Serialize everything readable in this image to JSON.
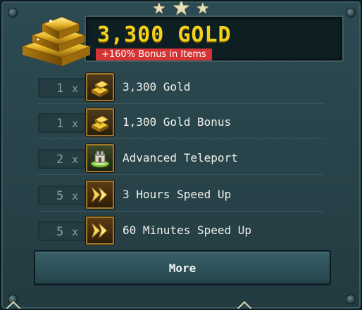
{
  "offer": {
    "title": "3,300 GOLD",
    "bonus_badge": "+160% Bonus in Items"
  },
  "items": [
    {
      "qty": "1",
      "multiplier": "x",
      "label": "3,300 Gold",
      "icon": "gold-bars-icon"
    },
    {
      "qty": "1",
      "multiplier": "x",
      "label": "1,300 Gold Bonus",
      "icon": "gold-bars-icon"
    },
    {
      "qty": "2",
      "multiplier": "x",
      "label": "Advanced Teleport",
      "icon": "teleport-icon"
    },
    {
      "qty": "5",
      "multiplier": "x",
      "label": "3 Hours Speed Up",
      "icon": "speed-up-icon"
    },
    {
      "qty": "5",
      "multiplier": "x",
      "label": "60 Minutes Speed Up",
      "icon": "speed-up-icon"
    }
  ],
  "more_button": {
    "label": "More"
  },
  "colors": {
    "panel": "#2c4a52",
    "title_gold": "#f2d21c",
    "badge_red": "#d43434",
    "item_text": "#f1f1ec",
    "icon_frame": "#a37a2c"
  }
}
